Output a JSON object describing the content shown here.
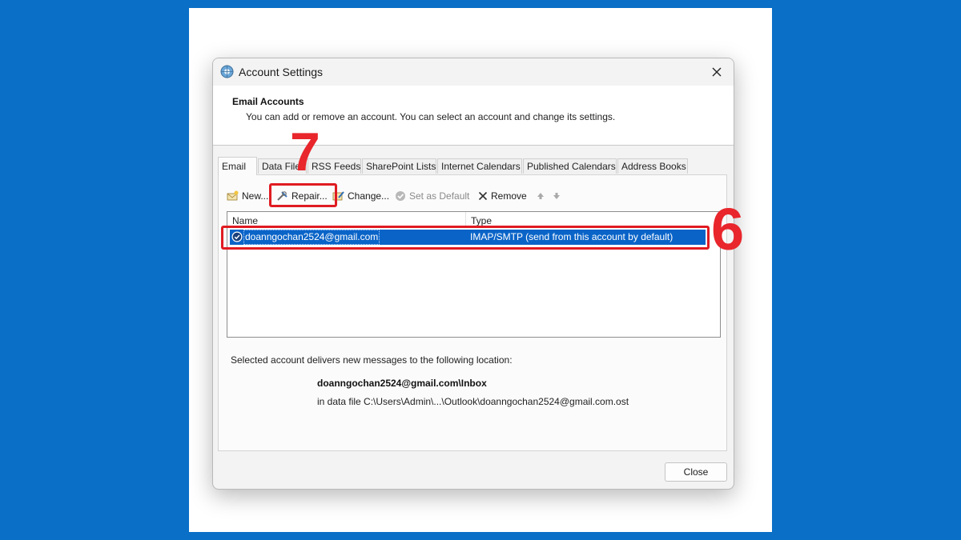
{
  "dialog": {
    "title": "Account Settings",
    "close_icon": "close-icon",
    "header": {
      "title": "Email Accounts",
      "description": "You can add or remove an account. You can select an account and change its settings."
    }
  },
  "tabs": [
    {
      "label": "Email",
      "active": true
    },
    {
      "label": "Data Files",
      "active": false
    },
    {
      "label": "RSS Feeds",
      "active": false
    },
    {
      "label": "SharePoint Lists",
      "active": false
    },
    {
      "label": "Internet Calendars",
      "active": false
    },
    {
      "label": "Published Calendars",
      "active": false
    },
    {
      "label": "Address Books",
      "active": false
    }
  ],
  "toolbar": {
    "new_label": "New...",
    "repair_label": "Repair...",
    "change_label": "Change...",
    "set_default_label": "Set as Default",
    "remove_label": "Remove",
    "move_up_icon": "arrow-up-icon",
    "move_down_icon": "arrow-down-icon"
  },
  "accounts_table": {
    "columns": [
      "Name",
      "Type"
    ],
    "rows": [
      {
        "name": "doanngochan2524@gmail.com",
        "type": "IMAP/SMTP (send from this account by default)",
        "selected": true,
        "default": true
      }
    ]
  },
  "delivery": {
    "label": "Selected account delivers new messages to the following location:",
    "location": "doanngochan2524@gmail.com\\Inbox",
    "data_file": "in data file C:\\Users\\Admin\\...\\Outlook\\doanngochan2524@gmail.com.ost"
  },
  "footer": {
    "close_label": "Close"
  },
  "annotations": {
    "step_repair": "7",
    "step_account": "6",
    "highlight_color": "#e01b22"
  },
  "colors": {
    "background": "#0a6fc6",
    "selection": "#0a64c8"
  }
}
